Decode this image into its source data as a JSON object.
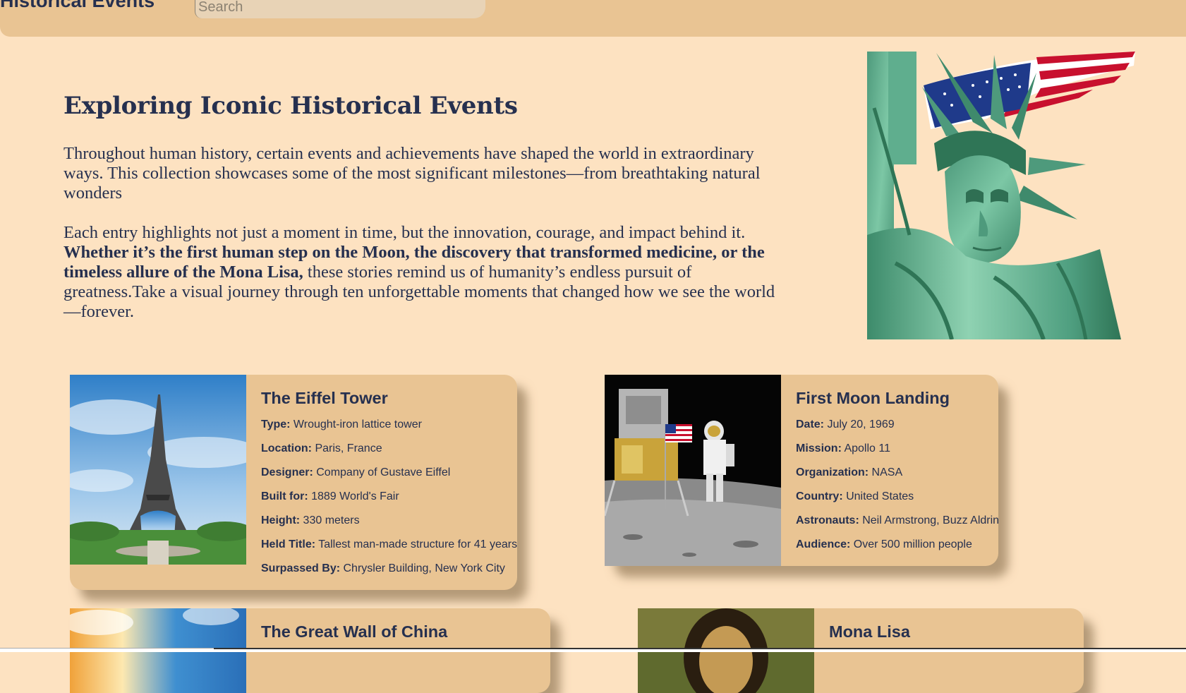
{
  "header": {
    "brand": "Historical Events",
    "search_placeholder": "Search"
  },
  "intro": {
    "title": "Exploring Iconic Historical Events",
    "para1": "Throughout human history, certain events and achievements have shaped the world in extraordinary ways. This collection showcases some of the most significant milestones—from breathtaking natural wonders",
    "para2_start": "Each entry highlights not just a moment in time, but the innovation, courage, and impact behind it. ",
    "para2_bold": "Whether it’s the first human step on the Moon, the discovery that transformed medicine, or the timeless allure of the Mona Lisa,",
    "para2_end": " these stories remind us of humanity’s endless pursuit of greatness.Take a visual journey through ten unforgettable moments that changed how we see the world—forever."
  },
  "cards": [
    {
      "title": "The Eiffel Tower",
      "rows": [
        {
          "label": "Type:",
          "value": " Wrought-iron lattice tower"
        },
        {
          "label": "Location:",
          "value": " Paris, France"
        },
        {
          "label": "Designer:",
          "value": " Company of Gustave Eiffel"
        },
        {
          "label": "Built for:",
          "value": " 1889 World's Fair"
        },
        {
          "label": "Height:",
          "value": " 330 meters"
        },
        {
          "label": "Held Title:",
          "value": " Tallest man-made structure for 41 years"
        },
        {
          "label": "Surpassed By:",
          "value": " Chrysler Building, New York City"
        }
      ]
    },
    {
      "title": "First Moon Landing",
      "rows": [
        {
          "label": "Date:",
          "value": " July 20, 1969"
        },
        {
          "label": "Mission:",
          "value": " Apollo 11"
        },
        {
          "label": "Organization:",
          "value": " NASA"
        },
        {
          "label": "Country:",
          "value": " United States"
        },
        {
          "label": "Astronauts:",
          "value": " Neil Armstrong, Buzz Aldrin"
        },
        {
          "label": "Audience:",
          "value": " Over 500 million people"
        }
      ]
    },
    {
      "title": "The Great Wall of China",
      "rows": []
    },
    {
      "title": "Mona Lisa",
      "rows": []
    }
  ],
  "colors": {
    "page_bg": "#fde2c1",
    "bar_bg": "#e9c493",
    "text": "#26304f"
  }
}
